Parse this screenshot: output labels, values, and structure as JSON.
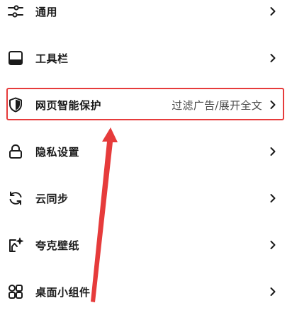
{
  "menu": {
    "items": [
      {
        "label": "通用",
        "value": "",
        "icon": "sliders-icon"
      },
      {
        "label": "工具栏",
        "value": "",
        "icon": "toolbar-icon"
      },
      {
        "label": "网页智能保护",
        "value": "过滤广告/展开全文",
        "icon": "shield-icon"
      },
      {
        "label": "隐私设置",
        "value": "",
        "icon": "lock-icon"
      },
      {
        "label": "云同步",
        "value": "",
        "icon": "sync-icon"
      },
      {
        "label": "夸克壁纸",
        "value": "",
        "icon": "wallpaper-icon"
      },
      {
        "label": "桌面小组件",
        "value": "",
        "icon": "widgets-icon"
      }
    ]
  },
  "annotation": {
    "highlight_color": "#e63b3b",
    "highlighted_item": "网页智能保护"
  },
  "colors": {
    "text": "#1a1a1a",
    "secondary_text": "#4a4a4a",
    "background": "#ffffff"
  }
}
